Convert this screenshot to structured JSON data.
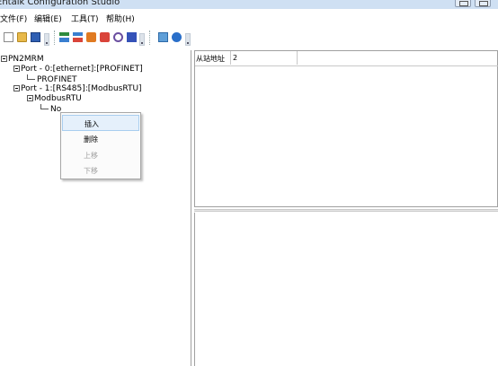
{
  "window": {
    "title": "Entalk Configuration Studio"
  },
  "menubar": {
    "items": [
      "文件(F)",
      "编辑(E)",
      "工具(T)",
      "帮助(H)"
    ]
  },
  "toolbar": {
    "icons": [
      "new-file-icon",
      "open-folder-icon",
      "save-icon",
      "add-node-icon",
      "add-slave-icon",
      "import-icon",
      "export-icon",
      "link-icon",
      "download-icon",
      "settings-icon",
      "info-icon"
    ]
  },
  "tree": {
    "root": "PN2MRM",
    "port0": "Port - 0:[ethernet]:[PROFINET]",
    "port0_child": "PROFINET",
    "port1": "Port - 1:[RS485]:[ModbusRTU]",
    "port1_child": "ModbusRTU",
    "node": "No"
  },
  "context_menu": {
    "insert": "插入",
    "delete": "删除",
    "move_up": "上移",
    "move_down": "下移"
  },
  "properties": {
    "station_address_label": "从站地址",
    "station_address_value": "2"
  }
}
